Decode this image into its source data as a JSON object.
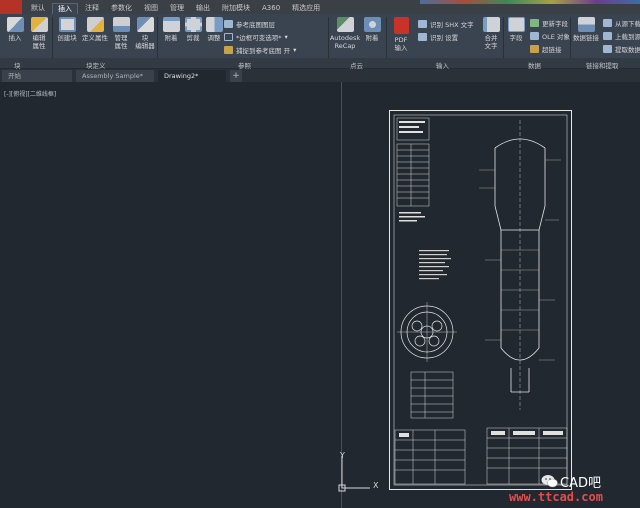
{
  "menu": {
    "tabs": [
      "默认",
      "插入",
      "注释",
      "参数化",
      "视图",
      "管理",
      "输出",
      "附加模块",
      "A360",
      "精选应用"
    ],
    "active_index": 1
  },
  "ribbon": {
    "block": {
      "insert": "插入",
      "edit_attr": "编辑\n属性"
    },
    "block_def": {
      "create": "创建块",
      "define_attr": "定义属性",
      "manage_attr": "管理\n属性",
      "block_editor": "块\n编辑器"
    },
    "reference": {
      "attach": "附着",
      "clip": "剪裁",
      "adjust": "调整",
      "underlay_layers": "参考底图图层",
      "frames_vary": "*边框可变选项*",
      "snap_underlay": "捕捉到参考底图 开"
    },
    "point_cloud": {
      "recap": "Autodesk\nReCap",
      "attach": "附着"
    },
    "import": {
      "pdf_import": "PDF\n输入",
      "recognize_shx": "识别 SHX 文字",
      "settings": "识别 设置"
    },
    "find": {
      "find_text": "合并\n文字"
    },
    "data": {
      "field": "字段",
      "update_fields": "更新字段",
      "ole_object": "OLE 对象",
      "hyperlink": "超链接"
    },
    "linking": {
      "data_link": "数据链接",
      "from_source": "从源下载",
      "upload_to_source": "上载到源",
      "extract_data": "提取数据"
    },
    "panel_titles": [
      "块",
      "块定义",
      "参照",
      "点云",
      "输入",
      "数据",
      "链接和提取"
    ]
  },
  "file_tabs": [
    "开始",
    "Assembly Sample*",
    "Drawing2*"
  ],
  "active_file_tab": 2,
  "viewport": {
    "label": "[-][俯视][二维线框]"
  },
  "ucs": {
    "x_label": "X",
    "y_label": "Y"
  },
  "watermark": {
    "brand": "CAD吧",
    "url": "www.ttcad.com"
  }
}
